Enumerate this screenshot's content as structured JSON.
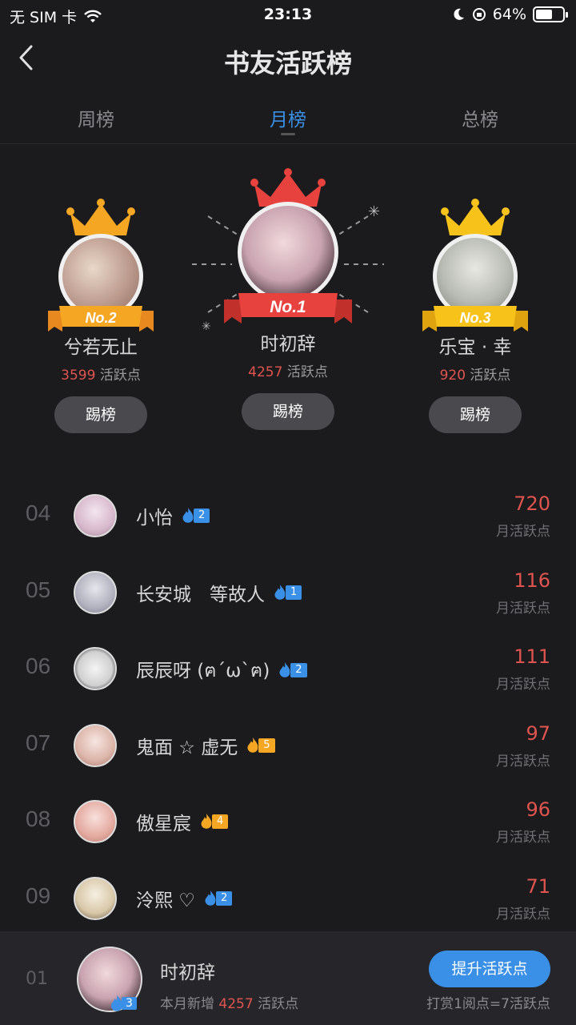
{
  "status": {
    "carrier": "无 SIM 卡",
    "time": "23:13",
    "battery": "64%",
    "battery_level": 0.64
  },
  "header": {
    "title": "书友活跃榜"
  },
  "tabs": [
    {
      "label": "周榜",
      "active": false
    },
    {
      "label": "月榜",
      "active": true
    },
    {
      "label": "总榜",
      "active": false
    }
  ],
  "podium": {
    "first": {
      "badge": "No.1",
      "name": "时初辞",
      "points": "4257",
      "unit": "活跃点",
      "kick": "踢榜"
    },
    "second": {
      "badge": "No.2",
      "name": "兮若无止",
      "points": "3599",
      "unit": "活跃点",
      "kick": "踢榜"
    },
    "third": {
      "badge": "No.3",
      "name": "乐宝 · 幸",
      "points": "920",
      "unit": "活跃点",
      "kick": "踢榜"
    }
  },
  "list": [
    {
      "rank": "04",
      "name": "小怡",
      "level": "2",
      "badge_color": "blue",
      "value": "720",
      "unit": "月活跃点"
    },
    {
      "rank": "05",
      "name": "长安城　等故人",
      "level": "1",
      "badge_color": "blue",
      "value": "116",
      "unit": "月活跃点"
    },
    {
      "rank": "06",
      "name": "辰辰呀 (ฅ´ω`ฅ)",
      "level": "2",
      "badge_color": "blue",
      "value": "111",
      "unit": "月活跃点"
    },
    {
      "rank": "07",
      "name": "鬼面 ☆ 虚无",
      "level": "5",
      "badge_color": "orange",
      "value": "97",
      "unit": "月活跃点"
    },
    {
      "rank": "08",
      "name": "傲星宸",
      "level": "4",
      "badge_color": "orange",
      "value": "96",
      "unit": "月活跃点"
    },
    {
      "rank": "09",
      "name": "泠熙 ♡",
      "level": "2",
      "badge_color": "blue",
      "value": "71",
      "unit": "月活跃点"
    }
  ],
  "me": {
    "rank": "01",
    "name": "时初辞",
    "level": "3",
    "sub_prefix": "本月新增",
    "sub_points": "4257",
    "sub_suffix": "活跃点",
    "button": "提升活跃点",
    "note": "打赏1阅点=7活跃点"
  },
  "colors": {
    "accent": "#3a8fe6",
    "points": "#e0544f",
    "gold": "#f5a623",
    "red_crown": "#e8423f"
  }
}
